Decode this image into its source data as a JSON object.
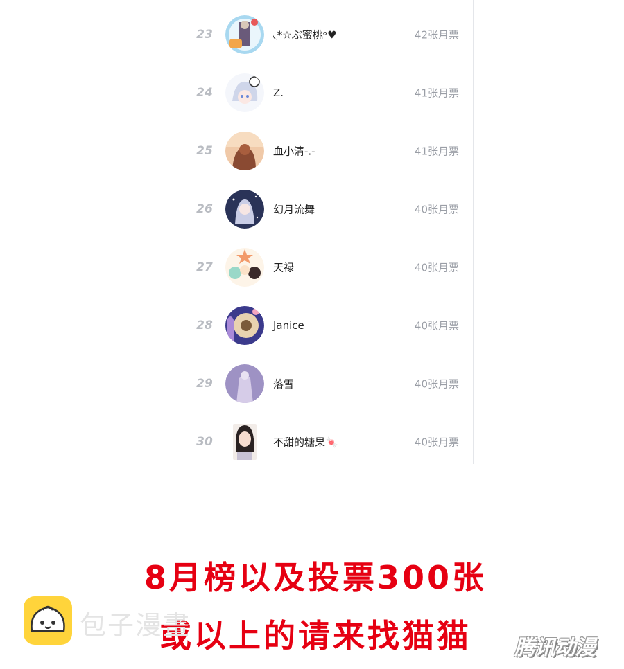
{
  "ranking": {
    "entries": [
      {
        "rank": "23",
        "name": "◟*☆ぷ蜜桃ᵒ♥",
        "votes": "42张月票"
      },
      {
        "rank": "24",
        "name": "Z.",
        "votes": "41张月票"
      },
      {
        "rank": "25",
        "name": "血小清-.-",
        "votes": "41张月票"
      },
      {
        "rank": "26",
        "name": "幻月流舞",
        "votes": "40张月票"
      },
      {
        "rank": "27",
        "name": "天禄",
        "votes": "40张月票"
      },
      {
        "rank": "28",
        "name": "Janice",
        "votes": "40张月票"
      },
      {
        "rank": "29",
        "name": "落雪",
        "votes": "40张月票"
      },
      {
        "rank": "30",
        "name": "不甜的糖果🍬",
        "votes": "40张月票"
      }
    ]
  },
  "notice": {
    "line1": "8月榜以及投票300张",
    "line2": "或以上的请来找猫猫"
  },
  "watermark": {
    "text": "包子漫畫",
    "corner_logo": "腾讯动漫",
    "colors": {
      "logo_bg": "#ffd43b",
      "notice": "#e60012"
    }
  }
}
